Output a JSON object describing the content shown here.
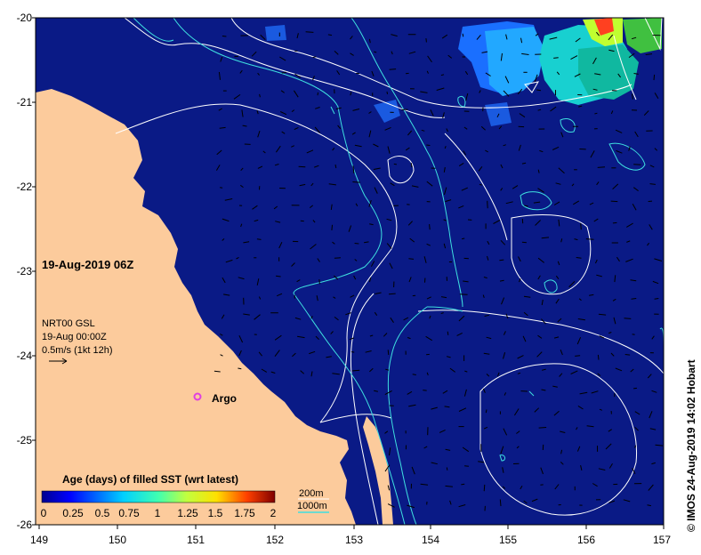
{
  "map": {
    "date_label": "19-Aug-2019 06Z",
    "model_lines": [
      "NRT00 GSL",
      "19-Aug 00:00Z",
      "0.5m/s (1kt 12h)"
    ],
    "argo_label": "Argo",
    "lat_labels": [
      "-20",
      "-21",
      "-22",
      "-23",
      "-24",
      "-25",
      "-26"
    ],
    "lon_labels": [
      "149",
      "150",
      "151",
      "152",
      "153",
      "154",
      "155",
      "156",
      "157"
    ],
    "colorbar": {
      "title": "Age (days) of filled SST (wrt latest)",
      "ticks": [
        "0",
        "0.25",
        "0.5",
        "0.75",
        "1",
        "1.25",
        "1.5",
        "1.75",
        "2"
      ],
      "range": [
        0,
        2
      ]
    },
    "contour_legend": {
      "label_200": "200m",
      "label_1000": "1000m"
    },
    "credit": "© IMOS 24-Aug-2019 14:02 Hobart",
    "colors": {
      "ocean": "#0a1a86",
      "land": "#fccb9c",
      "contour_200": "#ffffff",
      "contour_1000": "#3fe0e0",
      "argo": "#e040e0"
    }
  }
}
